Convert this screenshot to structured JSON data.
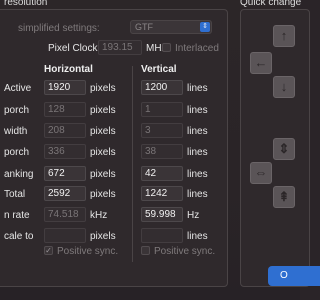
{
  "header": {
    "resolution_title": "resolution",
    "quick_change_title": "Quick change"
  },
  "settings": {
    "simplified_label": "simplified settings:",
    "simplified_value": "GTF",
    "pixel_clock_label": "Pixel Clock:",
    "pixel_clock_value": "193.15",
    "pixel_clock_unit": "MHz",
    "interlaced_label": "Interlaced"
  },
  "columns": {
    "horizontal": "Horizontal",
    "vertical": "Vertical"
  },
  "rows": [
    {
      "label": "Active",
      "h_value": "1920",
      "h_unit": "pixels",
      "v_value": "1200",
      "v_unit": "lines"
    },
    {
      "label": "porch",
      "h_value": "128",
      "h_unit": "pixels",
      "v_value": "1",
      "v_unit": "lines"
    },
    {
      "label": "width",
      "h_value": "208",
      "h_unit": "pixels",
      "v_value": "3",
      "v_unit": "lines"
    },
    {
      "label": "porch",
      "h_value": "336",
      "h_unit": "pixels",
      "v_value": "38",
      "v_unit": "lines"
    },
    {
      "label": "anking",
      "h_value": "672",
      "h_unit": "pixels",
      "v_value": "42",
      "v_unit": "lines"
    },
    {
      "label": "Total",
      "h_value": "2592",
      "h_unit": "pixels",
      "v_value": "1242",
      "v_unit": "lines"
    },
    {
      "label": "n rate",
      "h_value": "74.518",
      "h_unit": "kHz",
      "v_value": "59.998",
      "v_unit": "Hz"
    },
    {
      "label": "cale to",
      "h_value": "",
      "h_unit": "pixels",
      "v_value": "",
      "v_unit": "lines"
    }
  ],
  "sync": {
    "h_label": "Positive sync.",
    "v_label": "Positive sync."
  },
  "quick_change": {
    "up_icon": "↑",
    "left_icon": "←",
    "down_icon": "↓",
    "v_expand_icon": "⇕",
    "h_expand_icon": "⇔",
    "v_collapse_icon": "⇞"
  },
  "footer": {
    "ok_label": "O"
  }
}
